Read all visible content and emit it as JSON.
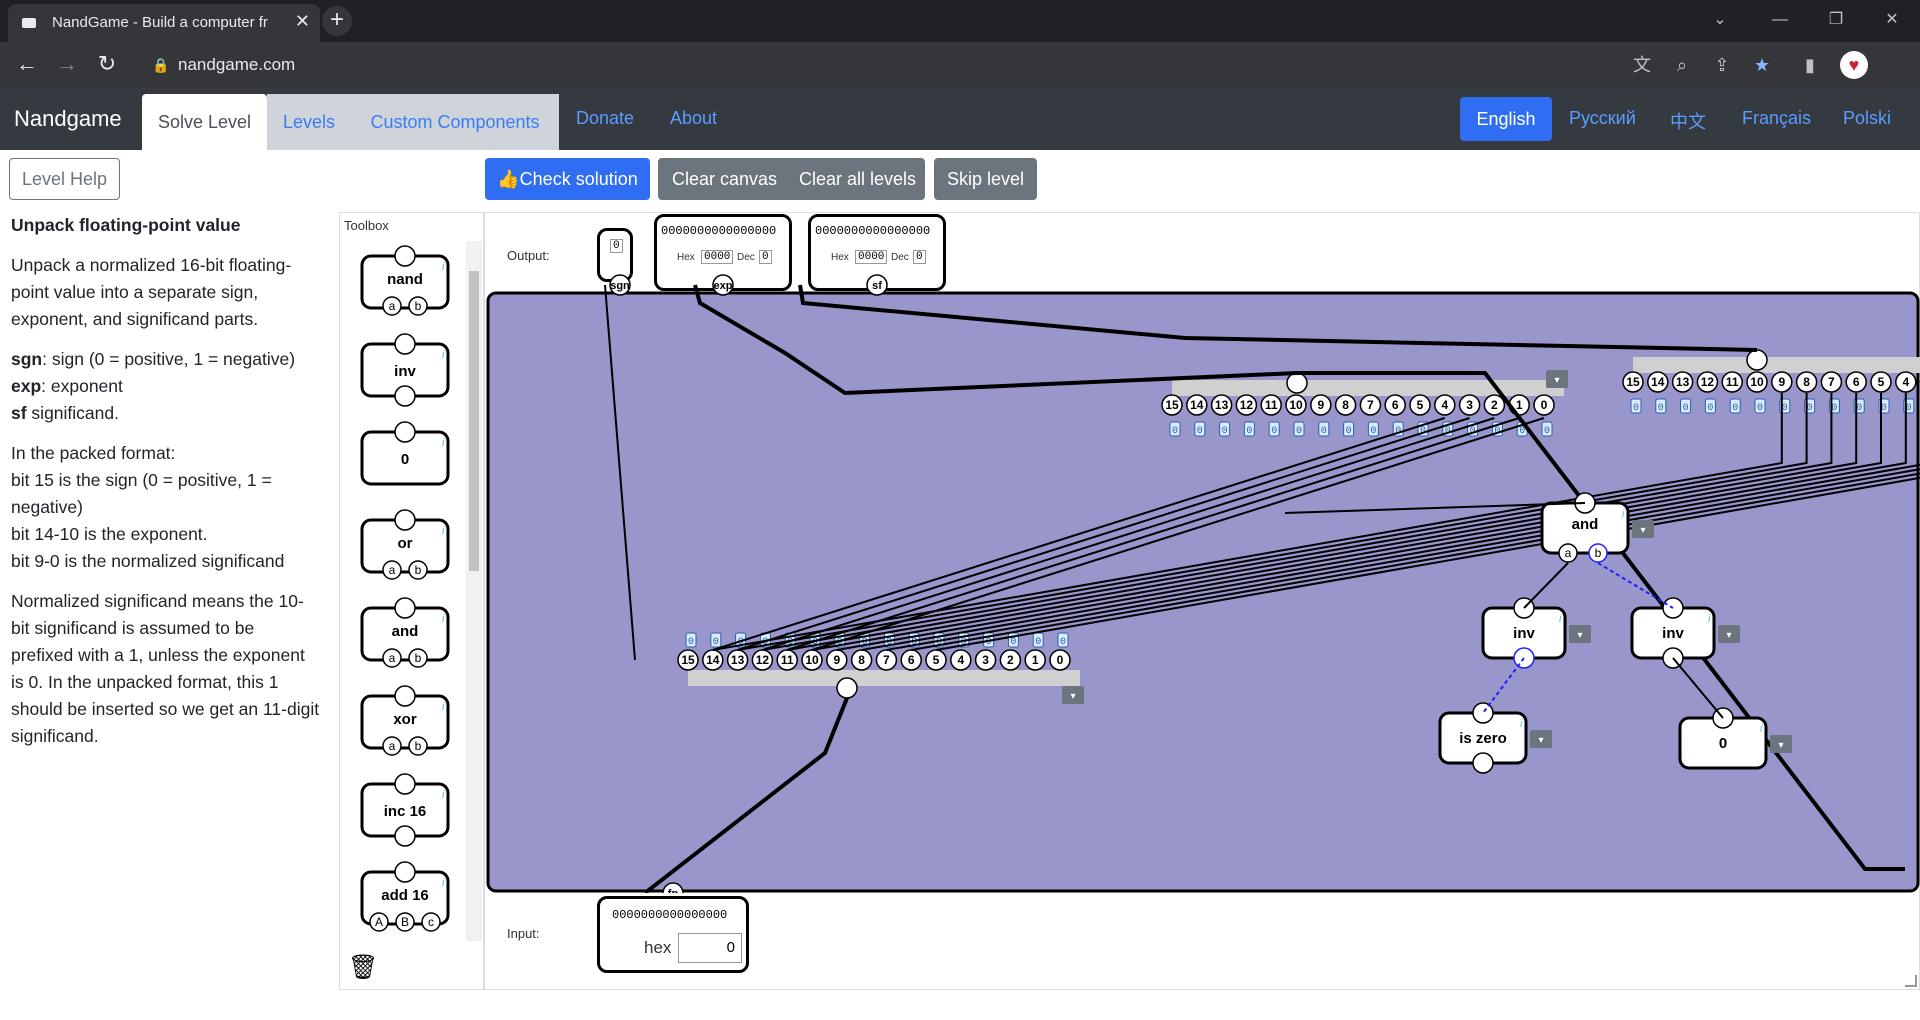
{
  "browser": {
    "tab_title": "NandGame - Build a computer fr",
    "url": "nandgame.com"
  },
  "nav": {
    "brand": "Nandgame",
    "tabs": [
      "Solve Level",
      "Levels",
      "Custom Components"
    ],
    "links": [
      "Donate",
      "About"
    ],
    "languages": [
      "English",
      "Русский",
      "中文",
      "Français",
      "Polski"
    ]
  },
  "actions": {
    "help": "Level Help",
    "check": "Check solution",
    "clear_canvas": "Clear canvas",
    "clear_levels": "Clear all levels",
    "skip": "Skip level"
  },
  "level": {
    "title": "Unpack floating-point value",
    "intro": "Unpack a normalized 16-bit floating-point value into a separate sign, exponent, and significand parts.",
    "defs": [
      {
        "k": "sgn",
        "v": ": sign (0 = positive, 1 = negative)"
      },
      {
        "k": "exp",
        "v": ": exponent"
      },
      {
        "k": "sf",
        "v": " significand."
      }
    ],
    "packed": [
      "In the packed format:",
      "bit 15 is the sign (0 = positive, 1 = negative)",
      "bit 14-10 is the exponent.",
      "bit 9-0 is the normalized significand"
    ],
    "note": "Normalized significand means the 10-bit significand is assumed to be prefixed with a 1, unless the exponent is 0. In the unpacked format, this 1 should be inserted so we get an 11-digit significand."
  },
  "toolbox": {
    "label": "Toolbox",
    "items": [
      {
        "name": "nand",
        "inputs": [
          "a",
          "b"
        ]
      },
      {
        "name": "inv",
        "inputs": []
      },
      {
        "name": "0",
        "inputs": []
      },
      {
        "name": "or",
        "inputs": [
          "a",
          "b"
        ]
      },
      {
        "name": "and",
        "inputs": [
          "a",
          "b"
        ]
      },
      {
        "name": "xor",
        "inputs": [
          "a",
          "b"
        ]
      },
      {
        "name": "inc 16",
        "inputs": []
      },
      {
        "name": "add 16",
        "inputs": [
          "A",
          "B",
          "c"
        ]
      }
    ]
  },
  "canvas": {
    "output_label": "Output:",
    "input_label": "Input:",
    "outputs": {
      "sgn": {
        "pin": "sgn",
        "value": "0"
      },
      "exp": {
        "pin": "exp",
        "bits": "0000000000000000",
        "hex": "0000",
        "dec": "0"
      },
      "sf": {
        "pin": "sf",
        "bits": "0000000000000000",
        "hex": "0000",
        "dec": "0"
      }
    },
    "input": {
      "pin": "fp",
      "bits": "0000000000000000",
      "hex_label": "hex",
      "hex_value": "0"
    },
    "bit_labels": [
      "15",
      "14",
      "13",
      "12",
      "11",
      "10",
      "9",
      "8",
      "7",
      "6",
      "5",
      "4",
      "3",
      "2",
      "1",
      "0"
    ],
    "hex_lbl": "Hex",
    "dec_lbl": "Dec",
    "gates": [
      {
        "name": "and",
        "pins": [
          "a",
          "b"
        ]
      },
      {
        "name": "inv"
      },
      {
        "name": "inv"
      },
      {
        "name": "is zero"
      },
      {
        "name": "0"
      }
    ]
  }
}
